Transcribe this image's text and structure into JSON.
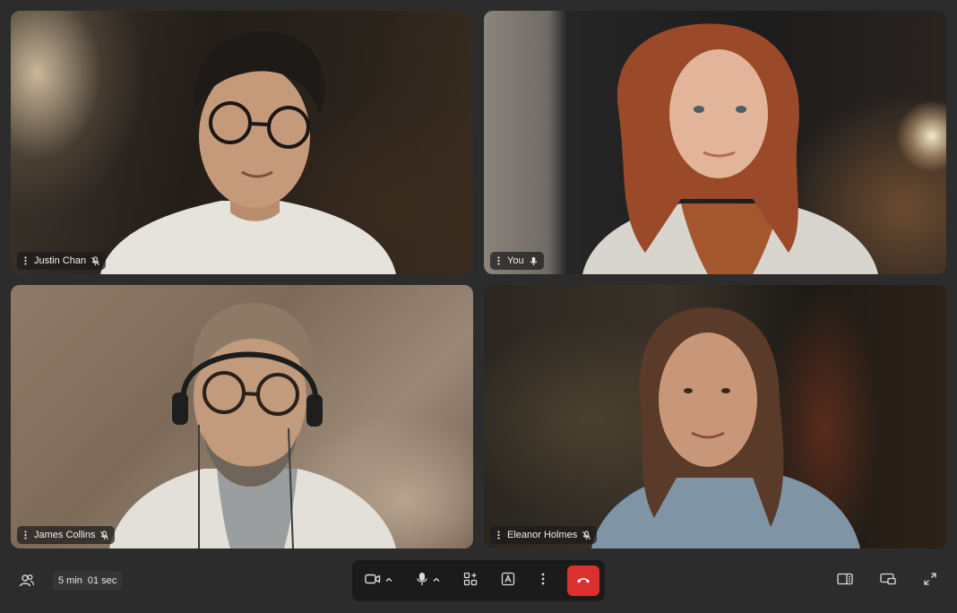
{
  "participants": [
    {
      "name": "Justin Chan",
      "mic": "muted"
    },
    {
      "name": "You",
      "mic": "on"
    },
    {
      "name": "James Collins",
      "mic": "muted"
    },
    {
      "name": "Eleanor Holmes",
      "mic": "muted"
    }
  ],
  "call": {
    "duration_minutes": "5 min",
    "duration_seconds": "01 sec"
  },
  "toolbar": {
    "left": [
      "people-icon"
    ],
    "center": [
      "video-camera-icon",
      "chevron-up-icon",
      "microphone-icon",
      "chevron-up-icon",
      "apps-icon",
      "captions-icon",
      "more-vertical-icon",
      "hang-up-icon"
    ],
    "right": [
      "side-panel-icon",
      "screen-share-icon",
      "fullscreen-icon"
    ]
  },
  "colors": {
    "background": "#2c2c2d",
    "control_bar": "#1b1b1c",
    "hang_up": "#dc2f2f",
    "name_tag": "#1c1c1c"
  }
}
